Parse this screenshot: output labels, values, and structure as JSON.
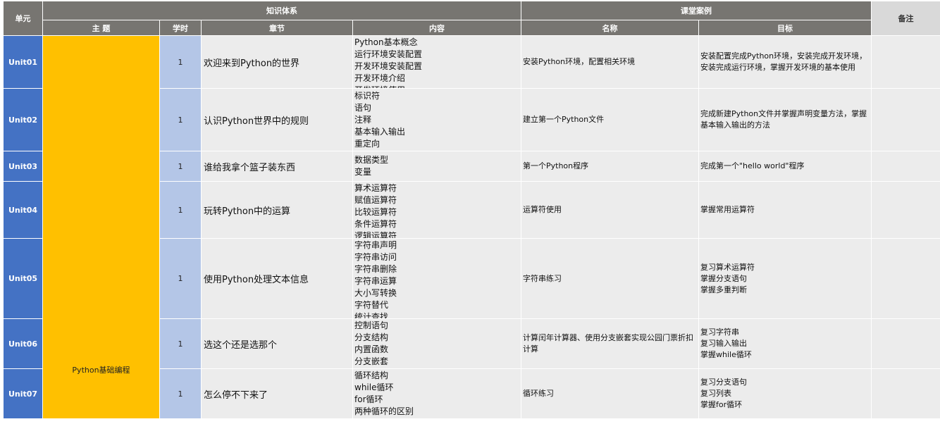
{
  "headers": {
    "unit": "单元",
    "knowledge_system": "知识体系",
    "class_cases": "课堂案例",
    "remark": "备注",
    "theme": "主 题",
    "hours": "学时",
    "chapter": "章节",
    "content": "内容",
    "case_name": "名称",
    "case_goal": "目标"
  },
  "theme_value": "Python基础编程",
  "rows": [
    {
      "unit": "Unit01",
      "hours": "1",
      "chapter": "欢迎来到Python的世界",
      "content": [
        "Python基本概念",
        "运行环境安装配置",
        "开发环境安装配置",
        "开发环境介绍",
        "开发环境使用"
      ],
      "case_name": "安装Python环境，配置相关环境",
      "case_goal": [
        "安装配置完成Python环境，安装完成开发环境，",
        "安装完成运行环境，掌握开发环境的基本使用"
      ]
    },
    {
      "unit": "Unit02",
      "hours": "1",
      "chapter": "认识Python世界中的规则",
      "content": [
        "标识符",
        "语句",
        "注释",
        "基本输入输出",
        "重定向"
      ],
      "case_name": "建立第一个Python文件",
      "case_goal": [
        "完成新建Python文件并掌握声明变量方法，掌握",
        "基本输入输出的方法"
      ]
    },
    {
      "unit": "Unit03",
      "hours": "1",
      "chapter": "谁给我拿个篮子装东西",
      "content": [
        "数据类型",
        "变量"
      ],
      "case_name": "第一个Python程序",
      "case_goal": [
        "完成第一个\"hello world\"程序"
      ]
    },
    {
      "unit": "Unit04",
      "hours": "1",
      "chapter": "玩转Python中的运算",
      "content": [
        "算术运算符",
        "赋值运算符",
        "比较运算符",
        "条件运算符",
        "逻辑运算符"
      ],
      "case_name": "运算符使用",
      "case_goal": [
        "掌握常用运算符"
      ]
    },
    {
      "unit": "Unit05",
      "hours": "1",
      "chapter": "使用Python处理文本信息",
      "content": [
        "字符串声明",
        "字符串访问",
        "字符串删除",
        "字符串运算",
        "大小写转换",
        "字符替代",
        "统计查找"
      ],
      "case_name": "字符串练习",
      "case_goal": [
        "复习算术运算符",
        "掌握分支语句",
        "掌握多重判断"
      ]
    },
    {
      "unit": "Unit06",
      "hours": "1",
      "chapter": "选这个还是选那个",
      "content": [
        "控制语句",
        "分支结构",
        "内置函数",
        "分支嵌套"
      ],
      "case_name": "计算闰年计算器、使用分支嵌套实现公园门票折扣计算",
      "case_goal": [
        "复习字符串",
        "复习输入输出",
        "掌握while循环"
      ]
    },
    {
      "unit": "Unit07",
      "hours": "1",
      "chapter": "怎么停不下来了",
      "content": [
        "循环结构",
        "while循环",
        "for循环",
        "两种循环的区别"
      ],
      "case_name": "循环练习",
      "case_goal": [
        "复习分支语句",
        "复习列表",
        "掌握for循环"
      ]
    }
  ]
}
